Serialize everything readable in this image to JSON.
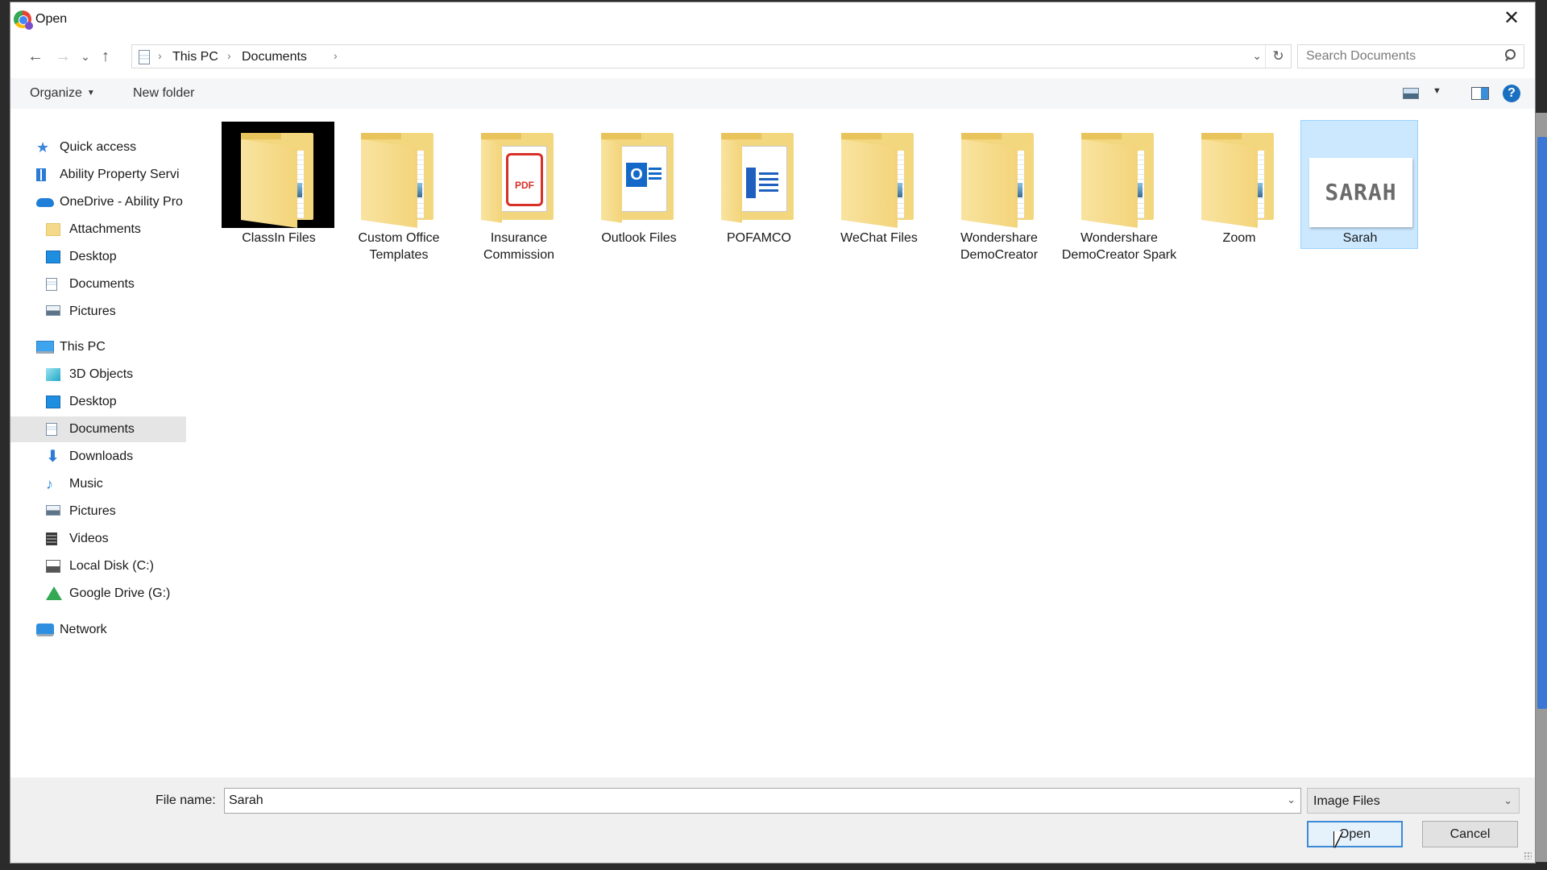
{
  "window": {
    "title": "Open",
    "close_label": "✕"
  },
  "navigation": {
    "back_icon": "←",
    "forward_icon": "→",
    "recent_icon": "⌄",
    "up_icon": "↑",
    "breadcrumbs": [
      "This PC",
      "Documents"
    ],
    "separator": "›",
    "dropdown_icon": "⌄",
    "refresh_icon": "↻"
  },
  "search": {
    "placeholder": "Search Documents",
    "value": ""
  },
  "toolbar": {
    "organize_label": "Organize",
    "organize_caret": "▼",
    "new_folder_label": "New folder",
    "view_caret": "▼",
    "help_label": "?"
  },
  "sidebar": {
    "items": [
      {
        "label": "Quick access",
        "icon": "star-icon"
      },
      {
        "label": "Ability Property Servi",
        "icon": "building-icon"
      },
      {
        "label": "OneDrive - Ability Pro",
        "icon": "cloud-icon"
      },
      {
        "label": "Attachments",
        "icon": "folder-icon"
      },
      {
        "label": "Desktop",
        "icon": "desktop-icon"
      },
      {
        "label": "Documents",
        "icon": "documents-icon"
      },
      {
        "label": "Pictures",
        "icon": "pictures-icon"
      },
      {
        "label": "This PC",
        "icon": "computer-icon"
      },
      {
        "label": "3D Objects",
        "icon": "cube-icon"
      },
      {
        "label": "Desktop",
        "icon": "desktop-icon"
      },
      {
        "label": "Documents",
        "icon": "documents-icon",
        "selected": true
      },
      {
        "label": "Downloads",
        "icon": "download-icon"
      },
      {
        "label": "Music",
        "icon": "music-icon"
      },
      {
        "label": "Pictures",
        "icon": "pictures-icon"
      },
      {
        "label": "Videos",
        "icon": "videos-icon"
      },
      {
        "label": "Local Disk (C:)",
        "icon": "disk-icon"
      },
      {
        "label": "Google Drive (G:)",
        "icon": "google-drive-icon"
      },
      {
        "label": "Network",
        "icon": "network-icon"
      }
    ],
    "glyphs": {
      "star": "★",
      "download": "⬇",
      "music": "♪"
    }
  },
  "files": [
    {
      "name": "ClassIn Files",
      "type": "folder"
    },
    {
      "name": "Custom Office Templates",
      "type": "folder"
    },
    {
      "name": "Insurance Commission",
      "type": "folder-pdf"
    },
    {
      "name": "Outlook Files",
      "type": "folder-outlook"
    },
    {
      "name": "POFAMCO",
      "type": "folder-word"
    },
    {
      "name": "WeChat Files",
      "type": "folder"
    },
    {
      "name": "Wondershare DemoCreator",
      "type": "folder"
    },
    {
      "name": "Wondershare DemoCreator Spark",
      "type": "folder"
    },
    {
      "name": "Zoom",
      "type": "folder"
    },
    {
      "name": "Sarah",
      "type": "image",
      "thumb_text": "SARAH",
      "selected": true
    }
  ],
  "file_icon_marks": {
    "pdf": "PDF",
    "outlook": "O"
  },
  "footer": {
    "file_name_label": "File name:",
    "file_name_value": "Sarah",
    "file_name_dropdown": "⌄",
    "file_type_value": "Image Files",
    "file_type_dropdown": "⌄",
    "open_label": "Open",
    "cancel_label": "Cancel"
  }
}
